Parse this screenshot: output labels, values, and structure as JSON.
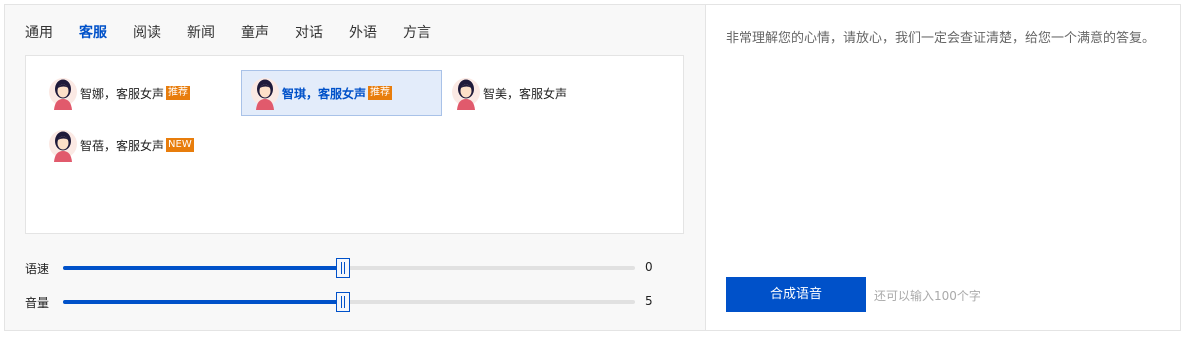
{
  "tabs": [
    {
      "label": "通用",
      "active": false
    },
    {
      "label": "客服",
      "active": true
    },
    {
      "label": "阅读",
      "active": false
    },
    {
      "label": "新闻",
      "active": false
    },
    {
      "label": "童声",
      "active": false
    },
    {
      "label": "对话",
      "active": false
    },
    {
      "label": "外语",
      "active": false
    },
    {
      "label": "方言",
      "active": false
    }
  ],
  "voices": [
    {
      "name": "智娜，客服女声",
      "badge": "推荐",
      "selected": false,
      "avatar": "female-avatar-icon"
    },
    {
      "name": "智琪，客服女声",
      "badge": "推荐",
      "selected": true,
      "avatar": "female-avatar-icon"
    },
    {
      "name": "智美，客服女声",
      "badge": "",
      "selected": false,
      "avatar": "female-avatar-icon"
    },
    {
      "name": "智蓓，客服女声",
      "badge": "NEW",
      "selected": false,
      "avatar": "female-avatar-icon"
    }
  ],
  "sliders": {
    "speed": {
      "label": "语速",
      "value": "0",
      "level": 0.49
    },
    "volume": {
      "label": "音量",
      "value": "5",
      "level": 0.49
    }
  },
  "text_panel": {
    "content": "非常理解您的心情，请放心，我们一定会查证清楚，给您一个满意的答复。",
    "button_label": "合成语音",
    "remaining": "还可以输入100个字"
  },
  "colors": {
    "accent": "#0051c9",
    "badge": "#e87d0c",
    "selected_bg": "#e3ecfa"
  }
}
